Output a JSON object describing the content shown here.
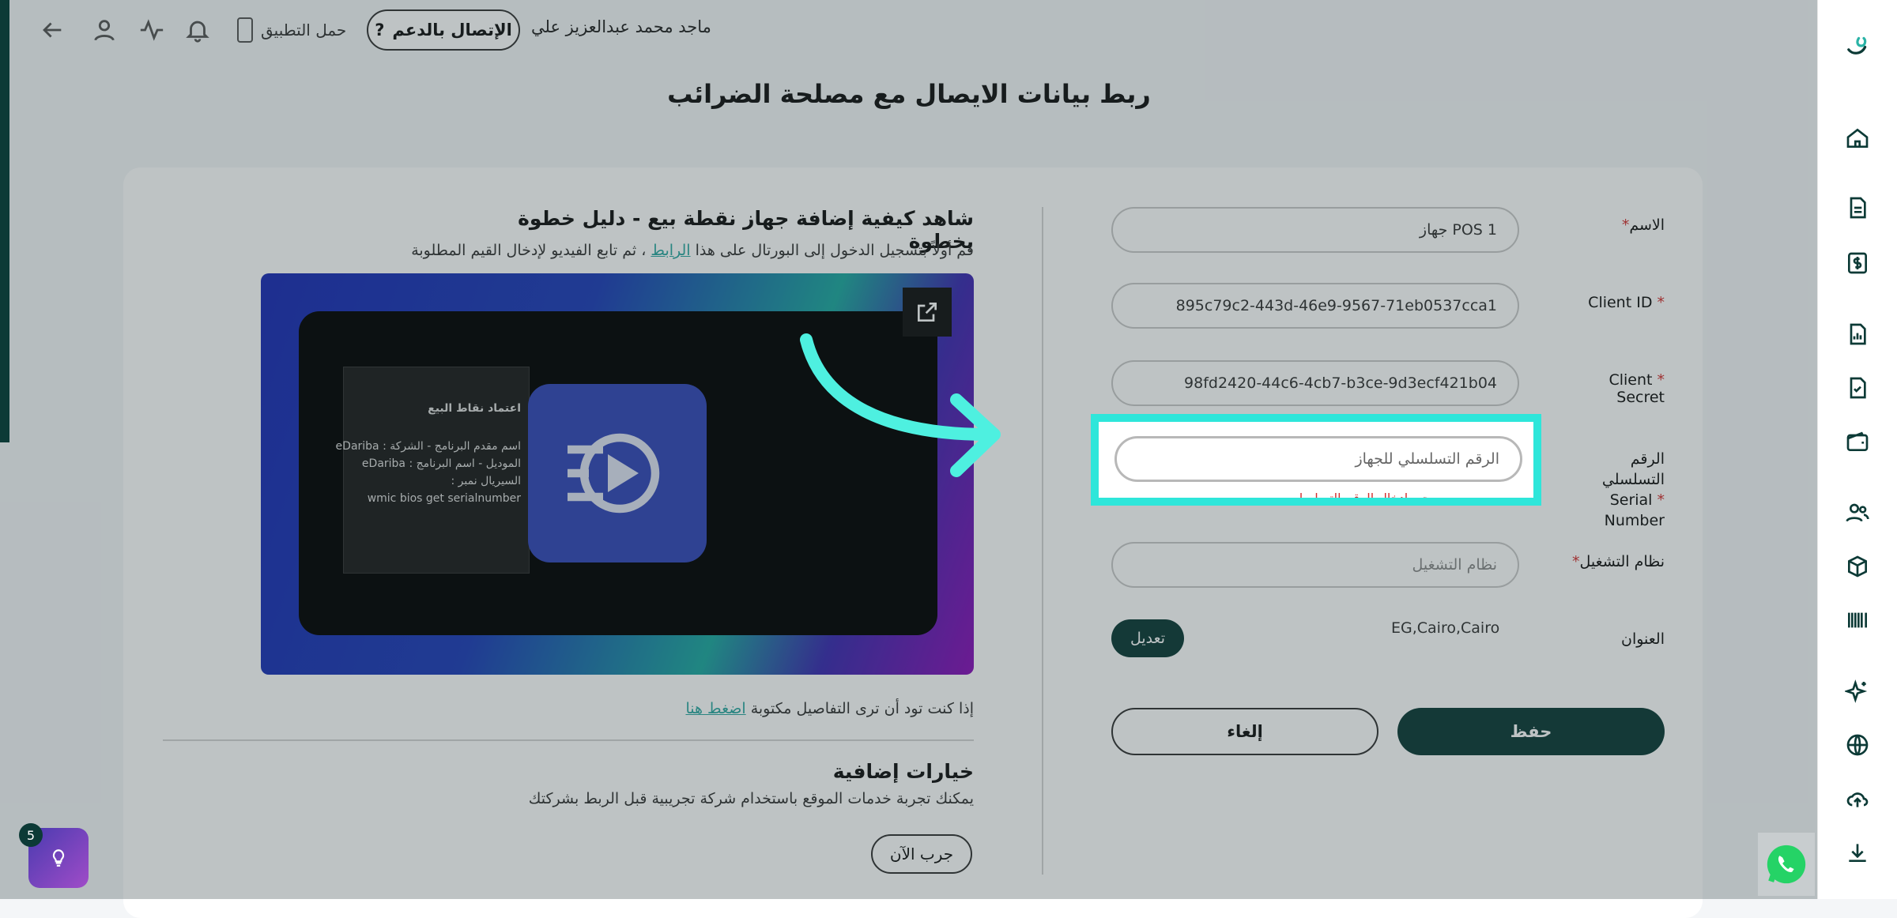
{
  "topbar": {
    "user_name": "ماجد محمد عبدالعزيز علي",
    "support_label": "الإتصال بالدعم",
    "support_icon": "?",
    "download_app_label": "حمل التطبيق"
  },
  "page_title": "ربط بيانات الايصال مع مصلحة الضرائب",
  "form": {
    "name_label": "الاسم",
    "name_value": "جهاز POS 1",
    "client_id_label": "Client ID",
    "client_id_value": "895c79c2-443d-46e9-9567-71eb0537cca1",
    "client_secret_label": "Client Secret",
    "client_secret_value": "98fd2420-44c6-4cb7-b3ce-9d3ecf421b04",
    "serial_label_ar": "الرقم التسلسلي",
    "serial_label_en": "Serial Number",
    "serial_placeholder": "الرقم التسلسلي للجهاز",
    "serial_error": "يرجى ادخال الرقم التسلسلي",
    "os_label": "نظام التشغيل",
    "os_placeholder": "نظام التشغيل",
    "address_label": "العنوان",
    "address_value": "EG,Cairo,Cairo",
    "edit_label": "تعديل",
    "save_label": "حفظ",
    "cancel_label": "إلغاء",
    "required_mark": "*"
  },
  "guide": {
    "title": "شاهد كيفية إضافة جهاز نقطة بيع - دليل خطوة بخطوة",
    "sub_before": "قم أولاً بتسجيل الدخول إلى البورتال على هذا ",
    "sub_link": "الرابط",
    "sub_after": " ، ثم تابع الفيديو لإدخال القيم المطلوبة",
    "video_lines": [
      "اعتماد نقاط البيع",
      "اسم مقدم البرنامج - الشركة : eDariba",
      "الموديل - اسم البرنامج : eDariba",
      "السيريال نمبر :",
      "wmic bios get serialnumber"
    ],
    "details_before": "إذا كنت تود أن ترى التفاصيل مكتوبة ",
    "details_link": "اضغط هنا"
  },
  "extra": {
    "title": "خيارات إضافية",
    "subtitle": "يمكنك تجربة خدمات الموقع باستخدام شركة تجريبية قبل الربط بشركتك",
    "try_label": "جرب الآن"
  },
  "hint_badge": "5",
  "colors": {
    "primary": "#0c3a36",
    "highlight": "#2ee6da",
    "error": "#d32f2f",
    "link": "#2aa6a0"
  },
  "sidebar_icons": [
    "home-icon",
    "document-icon",
    "dollar-icon",
    "chart-file-icon",
    "check-file-icon",
    "wallet-icon",
    "users-icon",
    "box-icon",
    "barcode-icon",
    "sparkle-icon",
    "globe-icon",
    "upload-icon",
    "download-icon"
  ]
}
